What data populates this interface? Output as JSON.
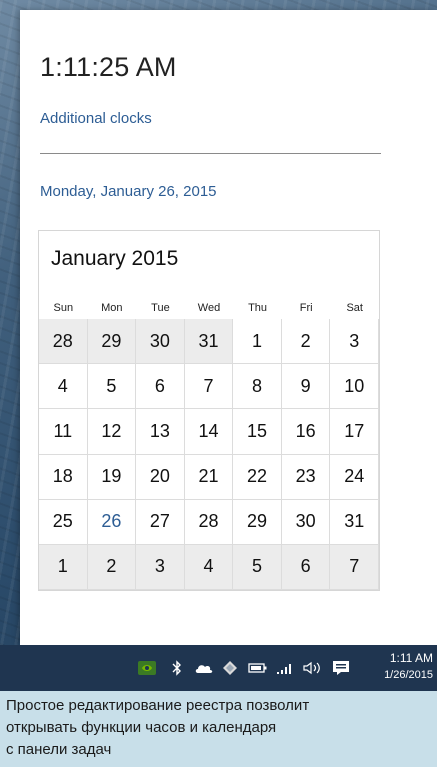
{
  "flyout": {
    "time": "1:11:25 AM",
    "additional_clocks": "Additional clocks",
    "date": "Monday, January 26, 2015"
  },
  "calendar": {
    "month_label": "January 2015",
    "weekdays": [
      "Sun",
      "Mon",
      "Tue",
      "Wed",
      "Thu",
      "Fri",
      "Sat"
    ],
    "weeks": [
      [
        "28",
        "29",
        "30",
        "31",
        "1",
        "2",
        "3"
      ],
      [
        "4",
        "5",
        "6",
        "7",
        "8",
        "9",
        "10"
      ],
      [
        "11",
        "12",
        "13",
        "14",
        "15",
        "16",
        "17"
      ],
      [
        "18",
        "19",
        "20",
        "21",
        "22",
        "23",
        "24"
      ],
      [
        "25",
        "26",
        "27",
        "28",
        "29",
        "30",
        "31"
      ],
      [
        "1",
        "2",
        "3",
        "4",
        "5",
        "6",
        "7"
      ]
    ],
    "selected_day": "26"
  },
  "taskbar": {
    "clock_time": "1:11 AM",
    "clock_date": "1/26/2015",
    "icons": [
      "nvidia-icon",
      "bluetooth-icon",
      "onedrive-icon",
      "dropbox-icon",
      "battery-icon",
      "network-icon",
      "volume-icon",
      "action-center-icon"
    ]
  },
  "caption": {
    "line1": "Простое редактирование реестра позволит",
    "line2": "открывать функции часов и календаря",
    "line3": "с панели задач"
  },
  "colors": {
    "accent": "#2d5d94",
    "taskbar": "#1f3550",
    "caption_bg": "#c8dfe9"
  }
}
